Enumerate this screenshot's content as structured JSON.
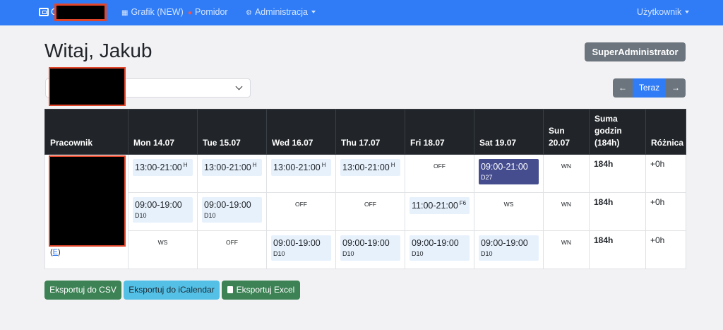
{
  "nav": {
    "brand_letter": "G",
    "grafik_label": "Grafik (NEW)",
    "pomidor_label": "Pomidor",
    "admin_label": "Administracja",
    "user_label": "Użytkownik"
  },
  "header": {
    "greeting": "Witaj, Jakub",
    "role": "SuperAdministrator"
  },
  "pager": {
    "prev": "←",
    "now": "Teraz",
    "next": "→"
  },
  "table": {
    "headers": {
      "employee": "Pracownik",
      "mon": "Mon 14.07",
      "tue": "Tue 15.07",
      "wed": "Wed 16.07",
      "thu": "Thu 17.07",
      "fri": "Fri 18.07",
      "sat": "Sat 19.07",
      "sun": "Sun 20.07",
      "sum": "Suma godzin (184h)",
      "diff": "Różnica"
    },
    "rows": [
      {
        "mon": {
          "time": "13:00-21:00",
          "tag": "H"
        },
        "tue": {
          "time": "13:00-21:00",
          "tag": "H"
        },
        "wed": {
          "time": "13:00-21:00",
          "tag": "H"
        },
        "thu": {
          "time": "13:00-21:00",
          "tag": "H"
        },
        "fri": "OFF",
        "sat": {
          "time": "09:00-21:00",
          "sub": "D27"
        },
        "sun": "WN",
        "sum": "184h",
        "diff": "+0h"
      },
      {
        "mon": {
          "time": "09:00-19:00",
          "sub": "D10"
        },
        "tue": {
          "time": "09:00-19:00",
          "sub": "D10"
        },
        "wed": "OFF",
        "thu": "OFF",
        "fri": {
          "time": "11:00-21:00",
          "tag": "F6"
        },
        "sat": "WS",
        "sun": "WN",
        "sum": "184h",
        "diff": "+0h"
      },
      {
        "mon": "WS",
        "tue": "OFF",
        "wed": {
          "time": "09:00-19:00",
          "sub": "D10"
        },
        "thu": {
          "time": "09:00-19:00",
          "sub": "D10"
        },
        "fri": {
          "time": "09:00-19:00",
          "sub": "D10"
        },
        "sat": {
          "time": "09:00-19:00",
          "sub": "D10"
        },
        "sun": "WN",
        "sum": "184h",
        "diff": "+0h"
      }
    ],
    "edit_open": "(",
    "edit_link": "E",
    "edit_close": ")"
  },
  "buttons": {
    "csv": "Eksportuj do CSV",
    "ical": "Eksportuj do iCalendar",
    "excel": "Eksportuj Excel"
  }
}
